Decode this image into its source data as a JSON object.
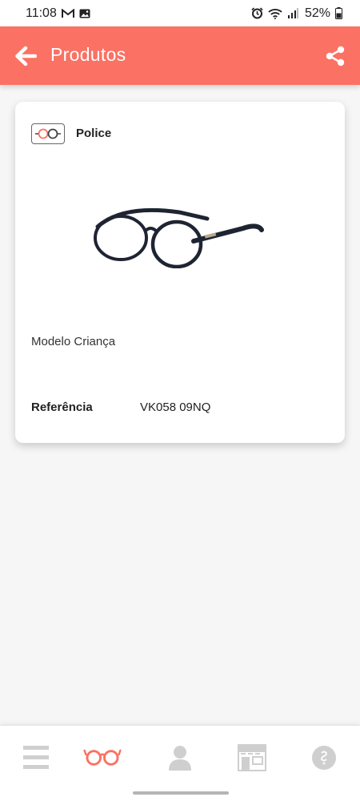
{
  "status_bar": {
    "time": "11:08",
    "battery": "52%",
    "icons": [
      "gmail-icon",
      "image-icon",
      "alarm-icon",
      "wifi-icon",
      "signal-icon",
      "battery-icon"
    ]
  },
  "app_bar": {
    "title": "Produtos",
    "back_icon": "arrow-left-icon",
    "share_icon": "share-icon",
    "color": "#fb7163"
  },
  "product": {
    "brand": "Police",
    "model": "Modelo Criança",
    "reference_label": "Referência",
    "reference_value": "VK058 09NQ"
  },
  "bottom_nav": {
    "items": [
      {
        "icon": "menu-icon",
        "active": false
      },
      {
        "icon": "glasses-icon",
        "active": true
      },
      {
        "icon": "profile-icon",
        "active": false
      },
      {
        "icon": "store-icon",
        "active": false
      },
      {
        "icon": "info-icon",
        "active": false
      }
    ],
    "active_color": "#fb7163",
    "inactive_color": "#cfcfcf"
  }
}
